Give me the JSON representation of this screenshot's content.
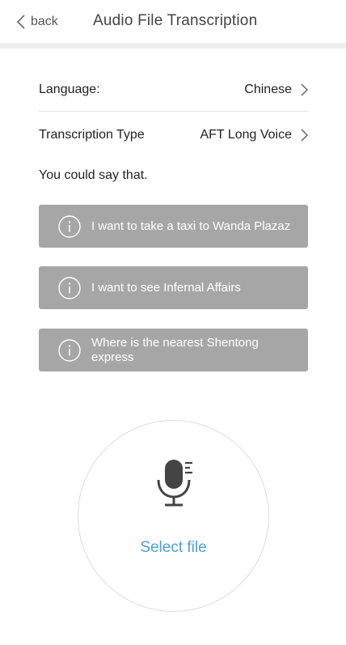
{
  "header": {
    "back_label": "back",
    "title": "Audio File Transcription"
  },
  "settings": {
    "language": {
      "label": "Language:",
      "value": "Chinese"
    },
    "transcription_type": {
      "label": "Transcription Type",
      "value": "AFT Long Voice"
    }
  },
  "hint": "You could say that.",
  "suggestions": [
    {
      "text": "I want to take a taxi to Wanda Plazaz"
    },
    {
      "text": "I want to see Infernal Affairs"
    },
    {
      "text": "Where is the nearest Shentong express"
    }
  ],
  "recorder": {
    "icon": "microphone-icon",
    "label": "Select file"
  },
  "colors": {
    "suggestion_bg": "#a6a6a6",
    "accent": "#4f9fd6",
    "icon_dark": "#444444"
  }
}
